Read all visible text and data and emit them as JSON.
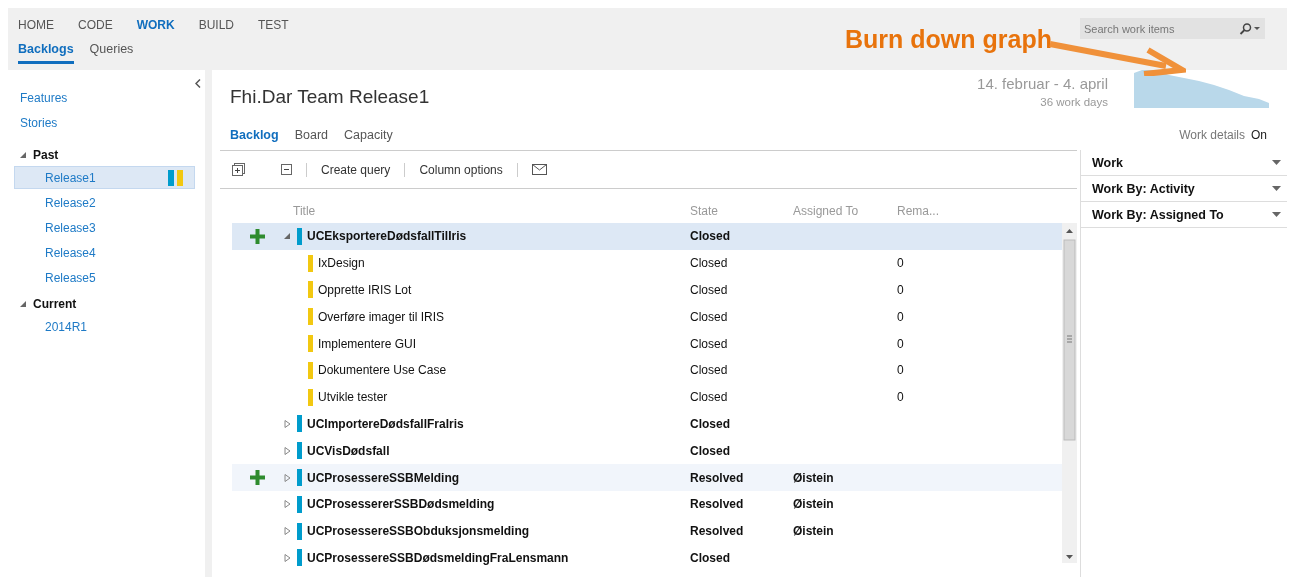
{
  "nav": {
    "tabs": [
      {
        "label": "HOME",
        "selected": false
      },
      {
        "label": "CODE",
        "selected": false
      },
      {
        "label": "WORK",
        "selected": true
      },
      {
        "label": "BUILD",
        "selected": false
      },
      {
        "label": "TEST",
        "selected": false
      }
    ],
    "subtabs": [
      {
        "label": "Backlogs",
        "selected": true
      },
      {
        "label": "Queries",
        "selected": false
      }
    ]
  },
  "search": {
    "placeholder": "Search work items"
  },
  "annotation": {
    "text": "Burn down graph"
  },
  "sidebar": {
    "links": [
      "Features",
      "Stories"
    ],
    "groups": [
      {
        "label": "Past",
        "expanded": true,
        "children": [
          {
            "label": "Release1",
            "selected": true
          },
          {
            "label": "Release2",
            "selected": false
          },
          {
            "label": "Release3",
            "selected": false
          },
          {
            "label": "Release4",
            "selected": false
          },
          {
            "label": "Release5",
            "selected": false
          }
        ]
      },
      {
        "label": "Current",
        "expanded": true,
        "children": [
          {
            "label": "2014R1",
            "selected": false
          }
        ]
      }
    ]
  },
  "header": {
    "title": "Fhi.Dar Team Release1",
    "date_range": "14. februar - 4. april",
    "work_days": "36 work days",
    "views": [
      {
        "label": "Backlog",
        "selected": true
      },
      {
        "label": "Board",
        "selected": false
      },
      {
        "label": "Capacity",
        "selected": false
      }
    ],
    "work_details": {
      "label": "Work details",
      "value": "On"
    }
  },
  "toolbar": {
    "actions": [
      "Create query",
      "Column options"
    ]
  },
  "table": {
    "columns": [
      "Title",
      "State",
      "Assigned To",
      "Rema..."
    ],
    "rows": [
      {
        "kind": "requirement",
        "title": "UCEksportereDødsfallTilIris",
        "state": "Closed",
        "selected": true,
        "hovered": false,
        "expanded": true,
        "children": [
          {
            "kind": "task",
            "title": "IxDesign",
            "state": "Closed",
            "remaining": "0"
          },
          {
            "kind": "task",
            "title": "Opprette IRIS Lot",
            "state": "Closed",
            "remaining": "0"
          },
          {
            "kind": "task",
            "title": "Overføre imager til IRIS",
            "state": "Closed",
            "remaining": "0"
          },
          {
            "kind": "task",
            "title": "Implementere GUI",
            "state": "Closed",
            "remaining": "0"
          },
          {
            "kind": "task",
            "title": "Dokumentere Use Case",
            "state": "Closed",
            "remaining": "0"
          },
          {
            "kind": "task",
            "title": "Utvikle tester",
            "state": "Closed",
            "remaining": "0"
          }
        ]
      },
      {
        "kind": "requirement",
        "title": "UCImportereDødsfallFraIris",
        "state": "Closed",
        "selected": false,
        "hovered": false,
        "expanded": false
      },
      {
        "kind": "requirement",
        "title": "UCVisDødsfall",
        "state": "Closed",
        "selected": false,
        "hovered": false,
        "expanded": false
      },
      {
        "kind": "requirement",
        "title": "UCProsessereSSBMelding",
        "state": "Resolved",
        "assigned_to": "Øistein",
        "selected": false,
        "hovered": true,
        "expanded": false
      },
      {
        "kind": "requirement",
        "title": "UCProsessererSSBDødsmelding",
        "state": "Resolved",
        "assigned_to": "Øistein",
        "selected": false,
        "hovered": false,
        "expanded": false
      },
      {
        "kind": "requirement",
        "title": "UCProsessereSSBObduksjonsmelding",
        "state": "Resolved",
        "assigned_to": "Øistein",
        "selected": false,
        "hovered": false,
        "expanded": false
      },
      {
        "kind": "requirement",
        "title": "UCProsessereSSBDødsmeldingFraLensmann",
        "state": "Closed",
        "selected": false,
        "hovered": false,
        "expanded": false
      }
    ]
  },
  "panels": [
    {
      "title": "Work"
    },
    {
      "title": "Work By: Activity"
    },
    {
      "title": "Work By: Assigned To"
    }
  ]
}
